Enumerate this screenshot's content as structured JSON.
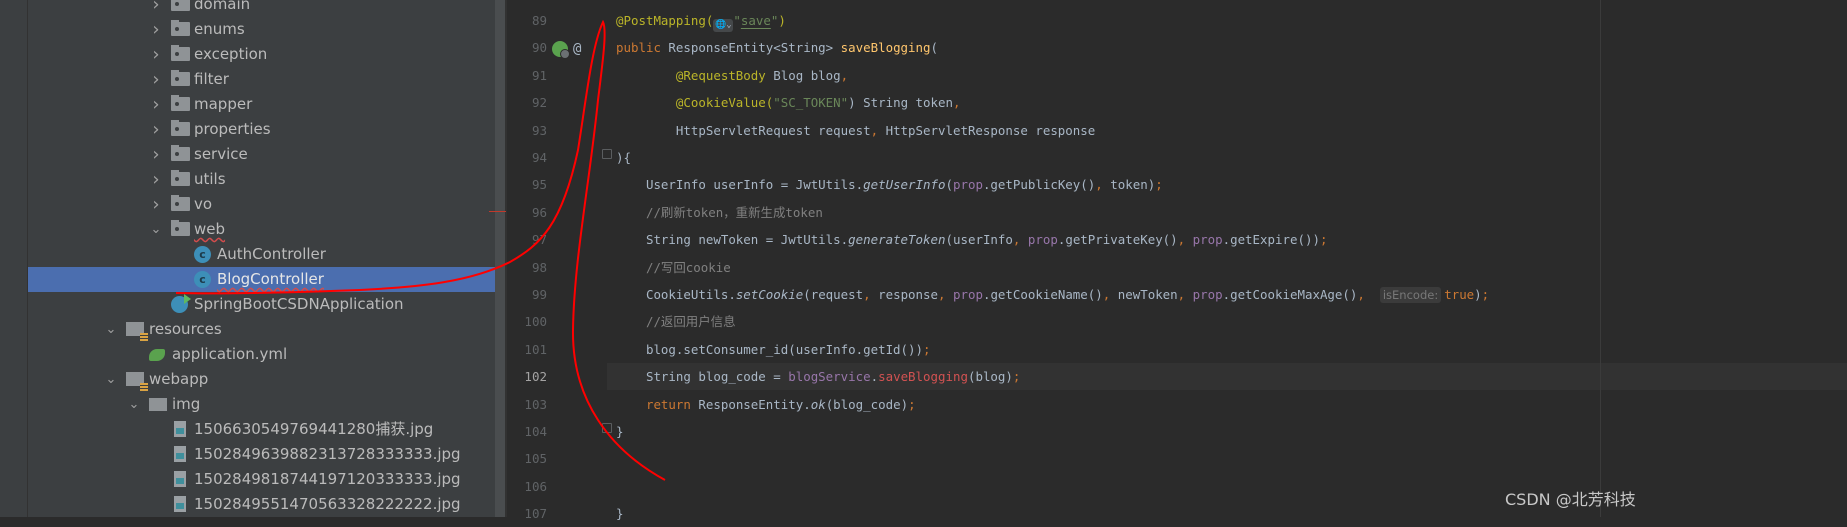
{
  "project_tree": {
    "items": [
      {
        "label": "domain",
        "type": "package",
        "depth": 3,
        "expanded": false
      },
      {
        "label": "enums",
        "type": "package",
        "depth": 3,
        "expanded": false
      },
      {
        "label": "exception",
        "type": "package",
        "depth": 3,
        "expanded": false
      },
      {
        "label": "filter",
        "type": "package",
        "depth": 3,
        "expanded": false
      },
      {
        "label": "mapper",
        "type": "package",
        "depth": 3,
        "expanded": false
      },
      {
        "label": "properties",
        "type": "package",
        "depth": 3,
        "expanded": false
      },
      {
        "label": "service",
        "type": "package",
        "depth": 3,
        "expanded": false
      },
      {
        "label": "utils",
        "type": "package",
        "depth": 3,
        "expanded": false
      },
      {
        "label": "vo",
        "type": "package",
        "depth": 3,
        "expanded": false
      },
      {
        "label": "web",
        "type": "package",
        "depth": 3,
        "expanded": true,
        "squiggle": true
      },
      {
        "label": "AuthController",
        "type": "class",
        "depth": 4
      },
      {
        "label": "BlogController",
        "type": "class",
        "depth": 4,
        "selected": true,
        "squiggle": true
      },
      {
        "label": "SpringBootCSDNApplication",
        "type": "spring-class",
        "depth": 3
      },
      {
        "label": "resources",
        "type": "resources-folder",
        "depth": 1,
        "expanded": true
      },
      {
        "label": "application.yml",
        "type": "yml",
        "depth": 2
      },
      {
        "label": "webapp",
        "type": "resources-folder",
        "depth": 1,
        "expanded": true
      },
      {
        "label": "img",
        "type": "folder",
        "depth": 2,
        "expanded": true
      },
      {
        "label": "1506630549769441280捕获.jpg",
        "type": "image",
        "depth": 3
      },
      {
        "label": "1502849639882313728333333.jpg",
        "type": "image",
        "depth": 3
      },
      {
        "label": "1502849818744197120333333.jpg",
        "type": "image",
        "depth": 3
      },
      {
        "label": "1502849551470563328222222.jpg",
        "type": "image",
        "depth": 3
      }
    ]
  },
  "editor": {
    "current_line": 102,
    "lines": [
      {
        "n": "89",
        "tokens": [
          [
            "@PostMapping(",
            "ann"
          ],
          [
            "🌐⌄",
            "glob"
          ],
          [
            "\"",
            "str"
          ],
          [
            "save",
            "strul"
          ],
          [
            "\"",
            "str"
          ],
          [
            ")",
            "ann"
          ]
        ]
      },
      {
        "n": "90",
        "tokens": [
          [
            "public ",
            "kw"
          ],
          [
            "ResponseEntity<String> ",
            ""
          ],
          [
            "saveBlogging",
            "fn"
          ],
          [
            "(",
            ""
          ]
        ]
      },
      {
        "n": "91",
        "tokens": [
          [
            "        ",
            ""
          ],
          [
            "@RequestBody",
            "ann"
          ],
          [
            " Blog blog",
            ""
          ],
          [
            ",",
            "kw"
          ]
        ]
      },
      {
        "n": "92",
        "tokens": [
          [
            "        ",
            ""
          ],
          [
            "@CookieValue(",
            "ann"
          ],
          [
            "\"SC_TOKEN\"",
            "str"
          ],
          [
            ") String token",
            ""
          ],
          [
            ",",
            "kw"
          ]
        ]
      },
      {
        "n": "93",
        "tokens": [
          [
            "        HttpServletRequest request",
            ""
          ],
          [
            ", ",
            "kw"
          ],
          [
            "HttpServletResponse response",
            ""
          ]
        ]
      },
      {
        "n": "94",
        "tokens": [
          [
            "){",
            ""
          ]
        ]
      },
      {
        "n": "95",
        "tokens": [
          [
            "    UserInfo userInfo = JwtUtils.",
            ""
          ],
          [
            "getUserInfo",
            "it"
          ],
          [
            "(",
            ""
          ],
          [
            "prop",
            "fld"
          ],
          [
            ".getPublicKey()",
            ""
          ],
          [
            ", ",
            "kw"
          ],
          [
            "token)",
            ""
          ],
          [
            ";",
            "kw"
          ]
        ]
      },
      {
        "n": "96",
        "tokens": [
          [
            "    //刷新token，重新生成token",
            "com"
          ]
        ]
      },
      {
        "n": "97",
        "tokens": [
          [
            "    String newToken = JwtUtils.",
            ""
          ],
          [
            "generateToken",
            "it"
          ],
          [
            "(userInfo",
            ""
          ],
          [
            ", ",
            "kw"
          ],
          [
            "prop",
            "fld"
          ],
          [
            ".getPrivateKey()",
            ""
          ],
          [
            ", ",
            "kw"
          ],
          [
            "prop",
            "fld"
          ],
          [
            ".getExpire())",
            ""
          ],
          [
            ";",
            "kw"
          ]
        ]
      },
      {
        "n": "98",
        "tokens": [
          [
            "    //写回cookie",
            "com"
          ]
        ]
      },
      {
        "n": "99",
        "tokens": [
          [
            "    CookieUtils.",
            ""
          ],
          [
            "setCookie",
            "it"
          ],
          [
            "(request",
            ""
          ],
          [
            ", ",
            "kw"
          ],
          [
            "response",
            ""
          ],
          [
            ", ",
            "kw"
          ],
          [
            "prop",
            "fld"
          ],
          [
            ".getCookieName()",
            ""
          ],
          [
            ", ",
            "kw"
          ],
          [
            "newToken",
            ""
          ],
          [
            ", ",
            "kw"
          ],
          [
            "prop",
            "fld"
          ],
          [
            ".getCookieMaxAge()",
            ""
          ],
          [
            ",  ",
            "kw"
          ],
          [
            "isEncode:",
            "hint"
          ],
          [
            "true",
            "kw"
          ],
          [
            ")",
            ""
          ],
          [
            ";",
            "kw"
          ]
        ]
      },
      {
        "n": "100",
        "tokens": [
          [
            "    //返回用户信息",
            "com"
          ]
        ]
      },
      {
        "n": "101",
        "tokens": [
          [
            "    blog.setConsumer_id(userInfo.getId())",
            ""
          ],
          [
            ";",
            "kw"
          ]
        ]
      },
      {
        "n": "102",
        "tokens": [
          [
            "    String blog_code = ",
            ""
          ],
          [
            "blogService",
            "fld"
          ],
          [
            ".",
            ""
          ],
          [
            "saveBlogging",
            "err"
          ],
          [
            "(blog)",
            ""
          ],
          [
            ";",
            "kw"
          ]
        ]
      },
      {
        "n": "103",
        "tokens": [
          [
            "    ",
            ""
          ],
          [
            "return ",
            "kw"
          ],
          [
            "ResponseEntity.",
            ""
          ],
          [
            "ok",
            "it"
          ],
          [
            "(blog_code)",
            ""
          ],
          [
            ";",
            "kw"
          ]
        ]
      },
      {
        "n": "104",
        "tokens": [
          [
            "}",
            ""
          ]
        ]
      },
      {
        "n": "105",
        "tokens": []
      },
      {
        "n": "106",
        "tokens": []
      },
      {
        "n": "107",
        "tokens": [
          [
            "}",
            ""
          ]
        ]
      }
    ],
    "gutter_icons": {
      "line_90": [
        "spring-bean-icon",
        "at-mapping-icon"
      ]
    }
  },
  "annotation_color": "#ff0000",
  "watermark": "CSDN @北芳科技",
  "colors": {
    "editor_bg": "#2b2b2b",
    "sidebar_bg": "#3c3f41",
    "selection": "#4b6eaf",
    "keyword": "#cc7832",
    "annotation": "#bbb529",
    "string": "#6a8759",
    "method": "#ffc66d",
    "field": "#9876aa",
    "comment": "#808080"
  }
}
